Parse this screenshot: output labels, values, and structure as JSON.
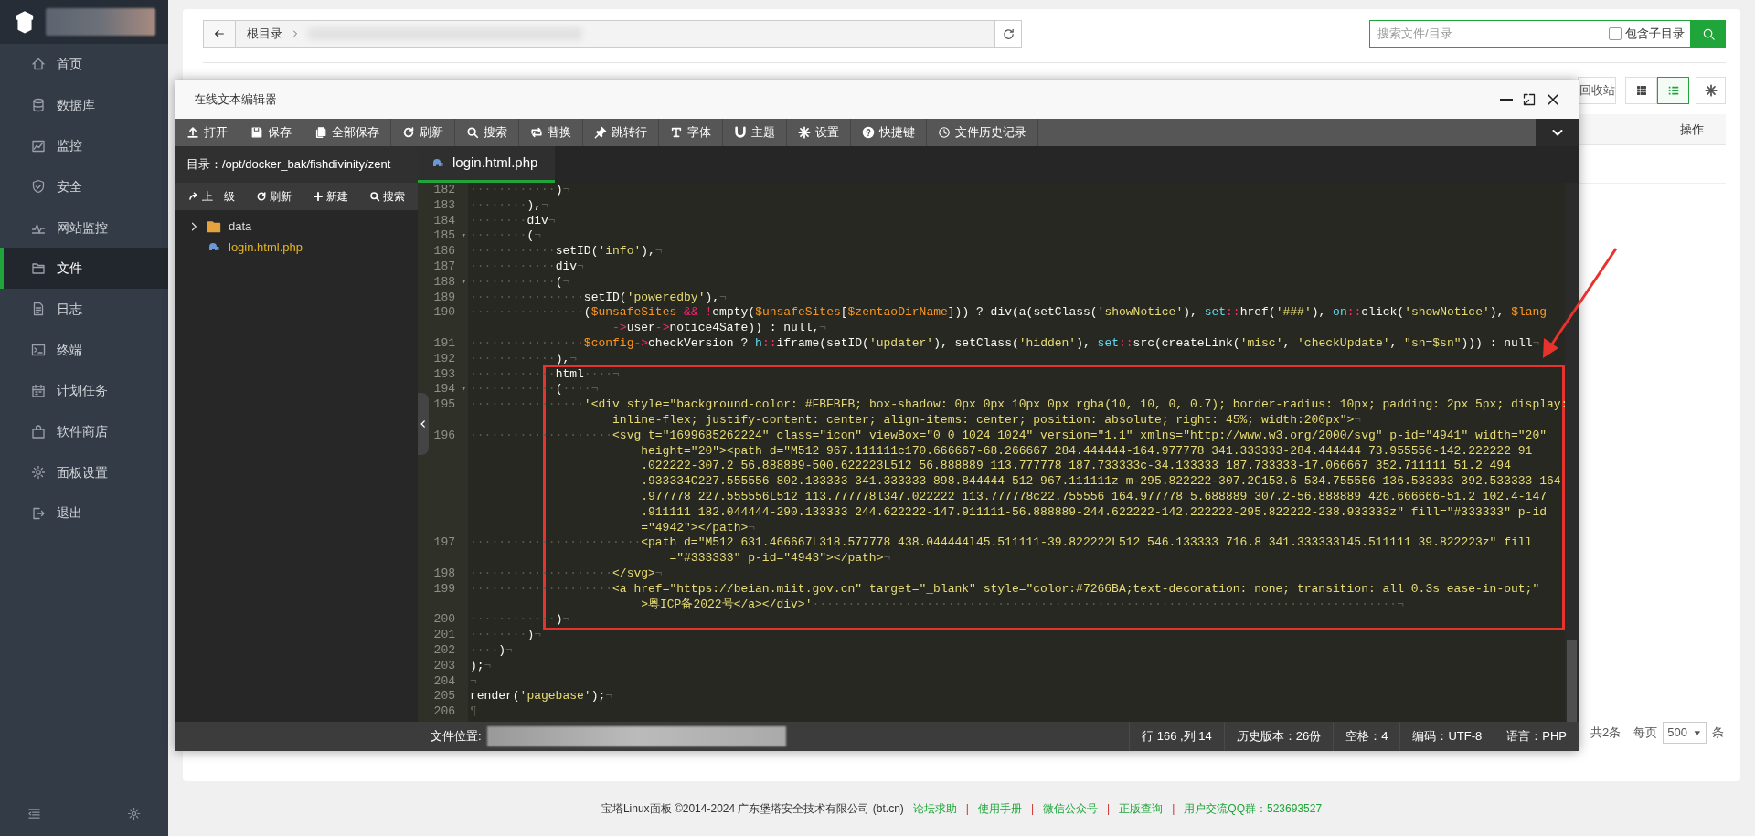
{
  "sidebar": {
    "items": [
      {
        "label": "首页",
        "selected": false
      },
      {
        "label": "数据库",
        "selected": false
      },
      {
        "label": "监控",
        "selected": false
      },
      {
        "label": "安全",
        "selected": false
      },
      {
        "label": "网站监控",
        "selected": false
      },
      {
        "label": "文件",
        "selected": true
      },
      {
        "label": "日志",
        "selected": false
      },
      {
        "label": "终端",
        "selected": false
      },
      {
        "label": "计划任务",
        "selected": false
      },
      {
        "label": "软件商店",
        "selected": false
      },
      {
        "label": "面板设置",
        "selected": false
      },
      {
        "label": "退出",
        "selected": false
      }
    ]
  },
  "file_manager": {
    "breadcrumb": "根目录",
    "search": {
      "placeholder": "搜索文件/目录"
    },
    "include_subdirs": {
      "label": "包含子目录",
      "checked": false
    },
    "recycle_button": "回收站",
    "view_modes": [
      {
        "selected": false
      },
      {
        "selected": true
      }
    ],
    "table": {
      "columns": [
        "操作"
      ]
    },
    "pagination": {
      "total": "共2条",
      "per_page_label": "每页",
      "per_page": "500",
      "unit": "条"
    }
  },
  "editor": {
    "title": "在线文本编辑器",
    "toolbar": [
      "打开",
      "保存",
      "全部保存",
      "刷新",
      "搜索",
      "替换",
      "跳转行",
      "字体",
      "主题",
      "设置",
      "快捷键",
      "文件历史记录"
    ],
    "directory": {
      "label": "目录：",
      "path": "/opt/docker_bak/fishdivinity/zent"
    },
    "tree_actions": [
      "上一级",
      "刷新",
      "新建",
      "搜索"
    ],
    "tree": [
      {
        "label": "data",
        "kind": "folder",
        "selected": false
      },
      {
        "label": "login.html.php",
        "kind": "file",
        "selected": true
      }
    ],
    "tabs": [
      {
        "label": "login.html.php",
        "selected": true
      }
    ],
    "code": [
      {
        "kind": "plain",
        "lines": [
          {
            "number": "182",
            "rows": [
              "············)¬"
            ]
          },
          {
            "number": "183",
            "rows": [
              "········),¬"
            ]
          },
          {
            "number": "184",
            "rows": [
              "········div¬"
            ]
          },
          {
            "number": "185",
            "fold_marker": "▾",
            "rows": [
              "········(¬"
            ]
          },
          {
            "number": "186",
            "rows": [
              "············setID('info'),¬"
            ]
          },
          {
            "number": "187",
            "rows": [
              "············div¬"
            ]
          },
          {
            "number": "188",
            "fold_marker": "▾",
            "rows": [
              "············(¬"
            ]
          },
          {
            "number": "189",
            "rows": [
              "················setID('poweredby'),¬"
            ]
          },
          {
            "number": "190",
            "rows": [
              "················($unsafeSites && !empty($unsafeSites[$zentaoDirName])) ? div(a(setClass('showNotice'), set::href('###'), on::click('showNotice'), $lang",
              "->user->notice4Safe)) : null,¬"
            ]
          },
          {
            "number": "191",
            "rows": [
              "················$config->checkVersion ? h::iframe(setID('updater'), setClass('hidden'), set::src(createLink('misc', 'checkUpdate', \"sn=$sn\"))) : null¬"
            ]
          },
          {
            "number": "192",
            "rows": [
              "············),¬"
            ]
          }
        ]
      },
      {
        "kind": "highlighted",
        "lines": [
          {
            "number": "193",
            "rows": [
              "············html····¬"
            ]
          },
          {
            "number": "194",
            "fold_marker": "▾",
            "rows": [
              "············(····¬"
            ]
          },
          {
            "number": "195",
            "rows": [
              "················'<div style=\"background-color: #FBFBFB; box-shadow: 0px 0px 10px 0px rgba(10, 10, 0, 0.7); border-radius: 10px; padding: 2px 5px; display:",
              "inline-flex; justify-content: center; align-items: center; position: absolute; right: 45%; width:200px\">¬"
            ]
          },
          {
            "number": "196",
            "rows": [
              "····················<svg t=\"1699685262224\" class=\"icon\" viewBox=\"0 0 1024 1024\" version=\"1.1\" xmlns=\"http://www.w3.org/2000/svg\" p-id=\"4941\" width=\"20\"",
              "height=\"20\"><path d=\"M512 967.111111c170.666667-68.266667 284.444444-164.977778 341.333333-284.444444 73.955556-142.222222 91",
              ".022222-307.2 56.888889-500.622223L512 56.888889 113.777778 187.733333c-34.133333 187.733333-17.066667 352.711111 51.2 494",
              ".933334C227.555556 802.133333 341.333333 898.844444 512 967.111111z m-295.822222-307.2C153.6 534.755556 136.533333 392.533333 164",
              ".977778 227.555556L512 113.777778l347.022222 113.777778c22.755556 164.977778 5.688889 307.2-56.888889 426.666666-51.2 102.4-147",
              ".911111 182.044444-290.133333 244.622222-147.911111-56.888889-244.622222-142.222222-295.822222-238.933333z\" fill=\"#333333\" p-id",
              "=\"4942\"></path>¬"
            ]
          },
          {
            "number": "197",
            "rows": [
              "························<path d=\"M512 631.466667L318.577778 438.044444l45.511111-39.822222L512 546.133333 716.8 341.333333l45.511111 39.822223z\" fill",
              "=\"#333333\" p-id=\"4943\"></path>¬"
            ]
          },
          {
            "number": "198",
            "rows": [
              "····················</svg>¬"
            ]
          },
          {
            "number": "199",
            "rows": [
              "····················<a href=\"https://beian.miit.gov.cn\" target=\"_blank\" style=\"color:#7266BA;text-decoration: none; transition: all 0.3s ease-in-out;\"",
              ">粤ICP备2022号</a></div>'··················································································¬"
            ]
          },
          {
            "number": "200",
            "rows": [
              "············)¬"
            ]
          }
        ]
      },
      {
        "kind": "plain",
        "lines": [
          {
            "number": "201",
            "rows": [
              "········)¬"
            ]
          },
          {
            "number": "202",
            "rows": [
              "····)¬"
            ]
          },
          {
            "number": "203",
            "rows": [
              ");¬"
            ]
          },
          {
            "number": "204",
            "rows": [
              "¬"
            ]
          },
          {
            "number": "205",
            "rows": [
              "render('pagebase');¬"
            ]
          },
          {
            "number": "206",
            "rows": [
              "¶"
            ]
          }
        ]
      }
    ],
    "status_bar": {
      "file_location_label": "文件位置:",
      "cursor": "行 166 ,列 14",
      "history": "历史版本：26份",
      "indent": "空格：4",
      "encoding": "编码：UTF-8",
      "language": "语言：PHP"
    }
  },
  "footer": {
    "copyright": "宝塔Linux面板 ©2014-2024 广东堡塔安全技术有限公司 (bt.cn)",
    "separator": "|",
    "links": [
      "论坛求助",
      "使用手册",
      "微信公众号",
      "正版查询",
      "用户交流QQ群：523693527"
    ]
  }
}
